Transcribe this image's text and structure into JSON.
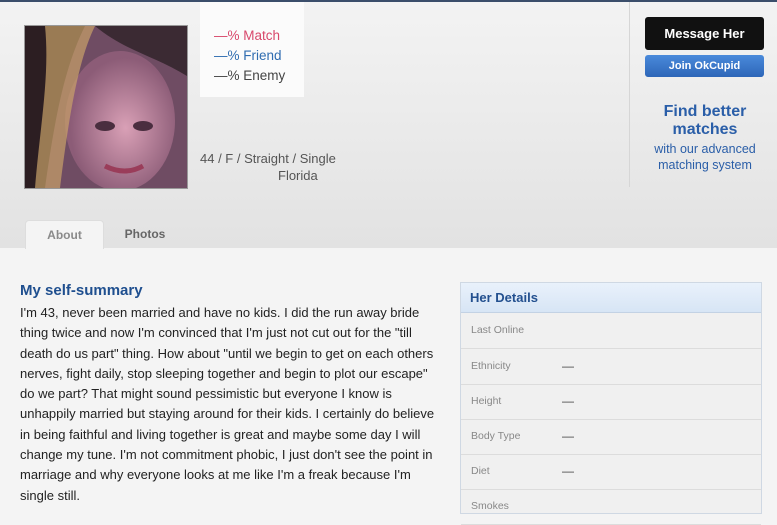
{
  "profile": {
    "match": "—% Match",
    "friend": "—% Friend",
    "enemy": "—% Enemy",
    "basics": "44 / F / Straight / Single",
    "location": "Florida"
  },
  "actions": {
    "message_label": "Message Her",
    "join_label": "Join OkCupid",
    "promo_title": "Find better matches",
    "promo_sub": "with our advanced matching system"
  },
  "tabs": [
    "About",
    "Photos"
  ],
  "essay": {
    "heading": "My self-summary",
    "text": "I'm 43, never been married and have no kids. I did the run away bride thing twice and now I'm convinced that I'm just not cut out for the \"till death do us part\" thing. How about \"until we begin to get on each others nerves, fight daily, stop sleeping together and begin to plot our escape\" do we part? That might sound pessimistic but everyone I know is unhappily married but staying around for their kids. I certainly do believe in being faithful and living together is great and maybe some day I will change my tune. I'm not commitment phobic, I just don't see the point in marriage and why everyone looks at me like I'm a freak because I'm single still."
  },
  "details": {
    "heading": "Her Details",
    "rows": [
      {
        "label": "Last Online",
        "value": ""
      },
      {
        "label": "Ethnicity",
        "value": "—"
      },
      {
        "label": "Height",
        "value": "—"
      },
      {
        "label": "Body Type",
        "value": "—"
      },
      {
        "label": "Diet",
        "value": "—"
      },
      {
        "label": "Smokes",
        "value": ""
      }
    ]
  },
  "colors": {
    "match": "#d8486b",
    "friend": "#2f6cb0",
    "accent": "#2a5ea8"
  }
}
